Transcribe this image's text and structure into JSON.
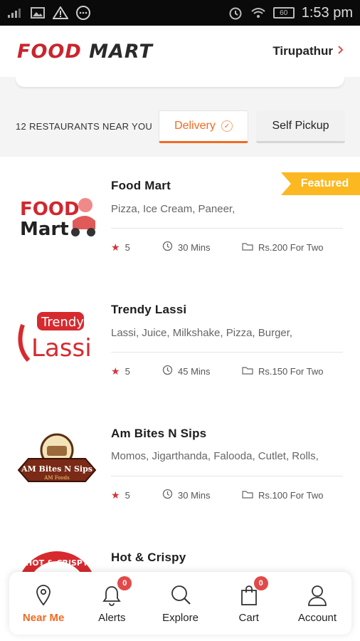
{
  "status_bar": {
    "time": "1:53 pm",
    "battery": "60"
  },
  "header": {
    "logo_food": "FOOD",
    "logo_mart": "MART",
    "location": "Tirupathur"
  },
  "filter": {
    "count_label": "12 RESTAURANTS NEAR YOU",
    "tab_delivery": "Delivery",
    "tab_pickup": "Self Pickup"
  },
  "restaurants": [
    {
      "name": "Food Mart",
      "cuisines": "Pizza, Ice Cream, Paneer,",
      "rating": "5",
      "time": "30 Mins",
      "cost": "Rs.200 For Two",
      "featured": "Featured"
    },
    {
      "name": "Trendy Lassi",
      "cuisines": "Lassi, Juice, Milkshake, Pizza, Burger,",
      "rating": "5",
      "time": "45 Mins",
      "cost": "Rs.150 For Two"
    },
    {
      "name": "Am Bites N Sips",
      "cuisines": "Momos, Jigarthanda, Falooda, Cutlet, Rolls,",
      "rating": "5",
      "time": "30 Mins",
      "cost": "Rs.100 For Two"
    },
    {
      "name": "Hot & Crispy"
    }
  ],
  "logos": {
    "food_mart": {
      "line1": "FOOD",
      "line2": "Mart"
    },
    "trendy_lassi": {
      "line1": "Trendy",
      "line2": "Lassi"
    },
    "am_bites": {
      "line1": "AM Bites N Sips",
      "line2": "AM Foods"
    },
    "hot_crispy": {
      "text": "HOT & CRISPY"
    }
  },
  "bottom_nav": [
    {
      "label": "Near Me",
      "icon": "location-pin-icon",
      "active": true
    },
    {
      "label": "Alerts",
      "icon": "bell-icon",
      "badge": "0"
    },
    {
      "label": "Explore",
      "icon": "search-icon"
    },
    {
      "label": "Cart",
      "icon": "shopping-bag-icon",
      "badge": "0"
    },
    {
      "label": "Account",
      "icon": "user-icon"
    }
  ],
  "colors": {
    "accent": "#f26a21",
    "brand_red": "#c9252d",
    "featured": "#fbb820",
    "star": "#d8313a"
  }
}
